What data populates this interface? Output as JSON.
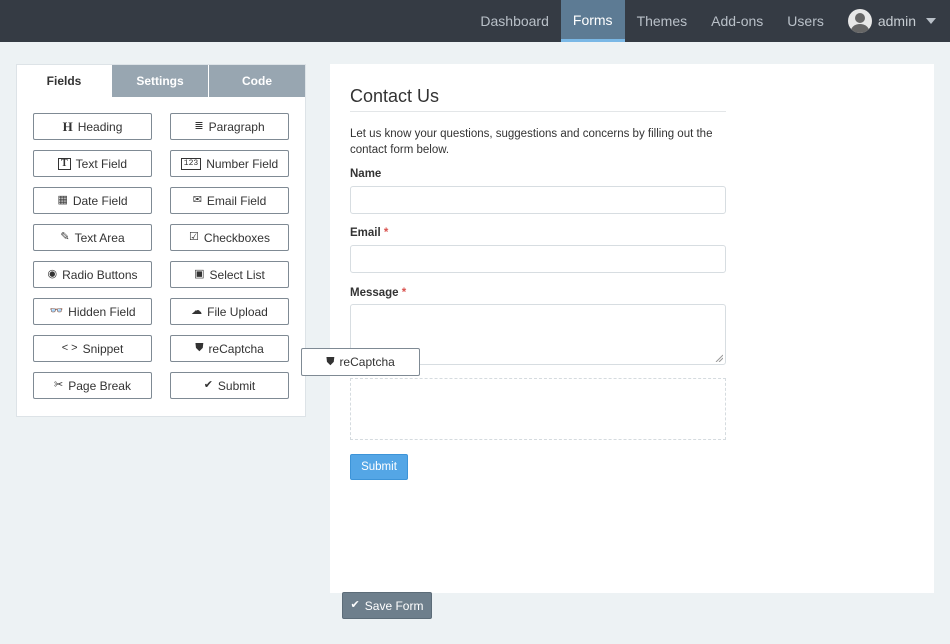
{
  "nav": {
    "items": [
      {
        "label": "Dashboard",
        "active": false
      },
      {
        "label": "Forms",
        "active": true
      },
      {
        "label": "Themes",
        "active": false
      },
      {
        "label": "Add-ons",
        "active": false
      },
      {
        "label": "Users",
        "active": false
      }
    ],
    "user": "admin"
  },
  "panel": {
    "tabs": [
      "Fields",
      "Settings",
      "Code"
    ],
    "fields": [
      {
        "label": "Heading",
        "icon": "heading-icon",
        "glyph": "H"
      },
      {
        "label": "Paragraph",
        "icon": "paragraph-icon",
        "glyph": "≣"
      },
      {
        "label": "Text Field",
        "icon": "text-field-icon",
        "glyph": "T"
      },
      {
        "label": "Number Field",
        "icon": "number-field-icon",
        "glyph": "123"
      },
      {
        "label": "Date Field",
        "icon": "calendar-icon",
        "glyph": "▦"
      },
      {
        "label": "Email Field",
        "icon": "envelope-icon",
        "glyph": "✉"
      },
      {
        "label": "Text Area",
        "icon": "edit-icon",
        "glyph": "✎"
      },
      {
        "label": "Checkboxes",
        "icon": "checkbox-icon",
        "glyph": "☑"
      },
      {
        "label": "Radio Buttons",
        "icon": "radio-icon",
        "glyph": "◉"
      },
      {
        "label": "Select List",
        "icon": "select-icon",
        "glyph": "▣"
      },
      {
        "label": "Hidden Field",
        "icon": "glasses-icon",
        "glyph": "👓"
      },
      {
        "label": "File Upload",
        "icon": "cloud-upload-icon",
        "glyph": "☁"
      },
      {
        "label": "Snippet",
        "icon": "code-icon",
        "glyph": "< >"
      },
      {
        "label": "reCaptcha",
        "icon": "shield-icon",
        "glyph": "⛊"
      },
      {
        "label": "Page Break",
        "icon": "scissors-icon",
        "glyph": "✂"
      },
      {
        "label": "Submit",
        "icon": "check-icon",
        "glyph": "✔"
      }
    ]
  },
  "drag": {
    "label": "reCaptcha",
    "icon": "shield-icon",
    "glyph": "⛊"
  },
  "form": {
    "title": "Contact Us",
    "description": "Let us know your questions, suggestions and concerns by filling out the contact form below.",
    "name_label": "Name",
    "email_label": "Email",
    "message_label": "Message",
    "required_mark": "*",
    "submit_label": "Submit"
  },
  "save_label": "Save Form",
  "save_glyph": "✔",
  "colors": {
    "accent": "#54a6e6",
    "nav_bg": "#353b44",
    "required": "#d9534f"
  }
}
